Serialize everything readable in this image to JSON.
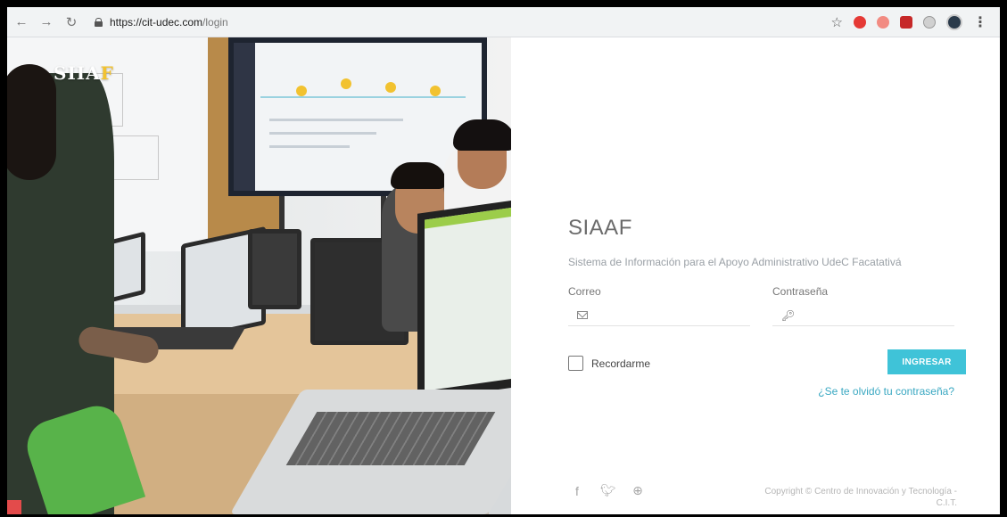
{
  "browser": {
    "url_host": "https://cit-udec.com",
    "url_path": "/login",
    "back_icon": "arrow-left-icon",
    "forward_icon": "arrow-right-icon",
    "reload_icon": "reload-icon",
    "extensions": [
      {
        "name": "adblock-icon",
        "color": "#e53935"
      },
      {
        "name": "chrome-extension-icon",
        "color": "#f28b82"
      },
      {
        "name": "pdf-extension-icon",
        "color": "#c62828"
      },
      {
        "name": "shield-extension-icon",
        "color": "#9e9e9e"
      }
    ]
  },
  "photo": {
    "logo_main": "SIIA",
    "logo_accent": "F"
  },
  "login": {
    "title": "SIAAF",
    "subtitle": "Sistema de Información para el Apoyo Administrativo UdeC Facatativá",
    "email_label": "Correo",
    "password_label": "Contraseña",
    "email_value": "",
    "password_value": "",
    "remember_label": "Recordarme",
    "submit_label": "INGRESAR",
    "forgot_label": "¿Se te olvidó tu contraseña?"
  },
  "footer": {
    "socials": [
      "facebook-icon",
      "twitter-icon",
      "dribbble-icon"
    ],
    "copyright_line1": "Copyright © Centro de Innovación y Tecnología -",
    "copyright_line2": "C.I.T."
  },
  "colors": {
    "accent": "#3fc3d8",
    "link": "#3aa8c2",
    "logo_accent": "#f2c230"
  }
}
